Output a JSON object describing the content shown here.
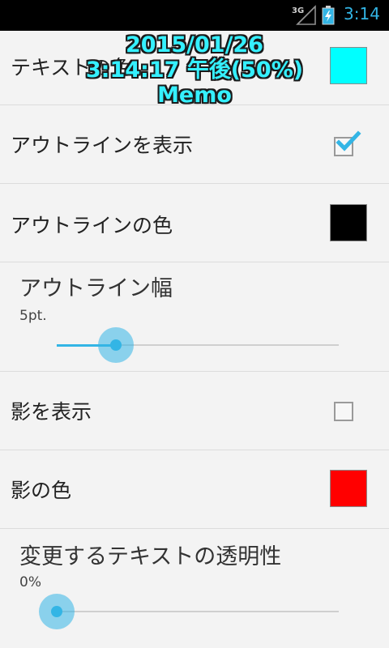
{
  "status_bar": {
    "network": "3G",
    "time": "3:14",
    "accent": "#33b5e5"
  },
  "overlay": {
    "date": "2015/01/26",
    "time": "3:14:17 午後(50%)",
    "label": "Memo",
    "text_color": "#35f0ff",
    "outline_color": "#1a1a1a"
  },
  "settings": {
    "text_color": {
      "label": "テキストの色",
      "swatch": "#00ffff"
    },
    "show_outline": {
      "label": "アウトラインを表示",
      "checked": true
    },
    "outline_color": {
      "label": "アウトラインの色",
      "swatch": "#000000"
    },
    "outline_width": {
      "title": "アウトライン幅",
      "value": "5pt.",
      "level": 0.21
    },
    "show_shadow": {
      "label": "影を表示",
      "checked": false
    },
    "shadow_color": {
      "label": "影の色",
      "swatch": "#ff0000"
    },
    "text_transparency": {
      "title": "変更するテキストの透明性",
      "value": "0%",
      "level": 0.0
    }
  }
}
